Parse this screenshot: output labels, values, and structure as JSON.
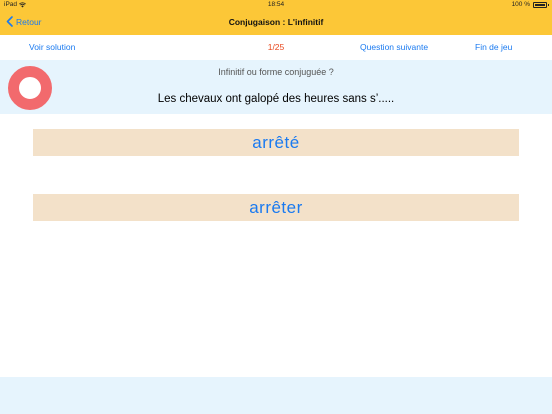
{
  "status_bar": {
    "device": "iPad",
    "time": "18:54",
    "battery": "100 %"
  },
  "nav_bar": {
    "back_label": "Retour",
    "title": "Conjugaison : L'infinitif"
  },
  "toolbar": {
    "see_solution": "Voir solution",
    "counter": "1/25",
    "next_question": "Question suivante",
    "end_game": "Fin de jeu"
  },
  "question": {
    "hint": "Infinitif ou forme conjuguée ?",
    "sentence": "Les chevaux ont galopé des heures sans s’....."
  },
  "answers": [
    {
      "label": "arrêté"
    },
    {
      "label": "arrêter"
    }
  ],
  "colors": {
    "accent": "#1a7af0",
    "bar": "#fcc737",
    "counter": "#e8471d",
    "panel": "#e6f4fd",
    "answer_bg": "#f3e1c9",
    "ring": "#f26a6d"
  },
  "icons": {
    "back": "chevron-left-icon",
    "wifi": "wifi-icon",
    "battery": "battery-icon",
    "indicator": "ring-icon"
  }
}
